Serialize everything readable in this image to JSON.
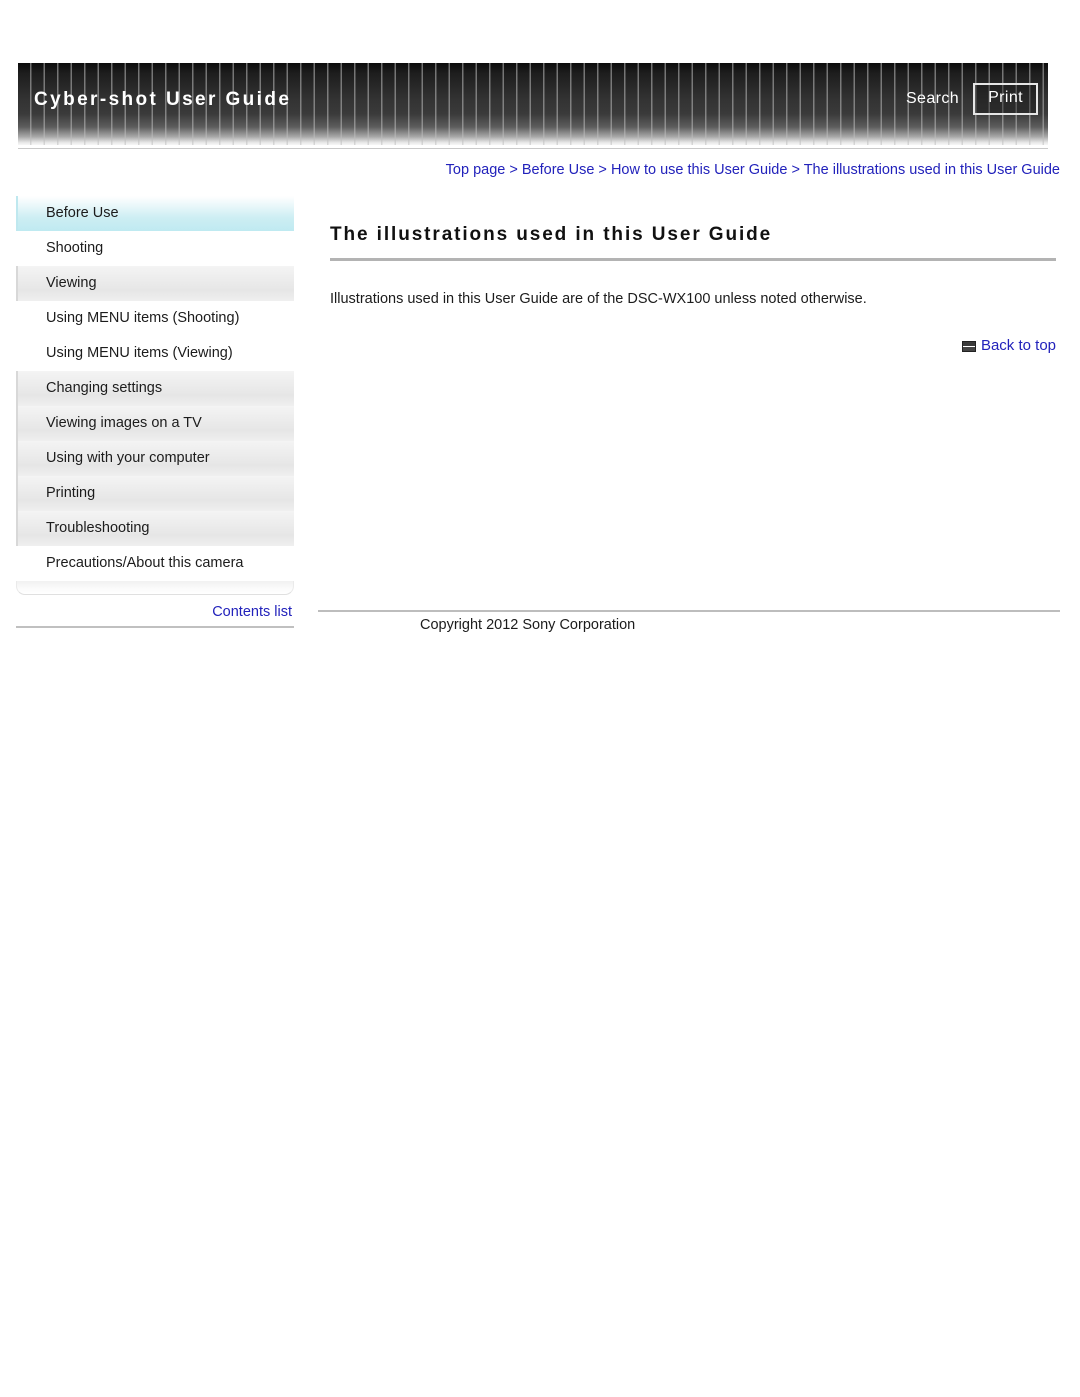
{
  "header": {
    "title": "Cyber-shot User Guide",
    "search_label": "Search",
    "print_label": "Print"
  },
  "breadcrumb": {
    "separator": " > ",
    "items": [
      "Top page",
      "Before Use",
      "How to use this User Guide",
      "The illustrations used in this User Guide"
    ]
  },
  "sidebar": {
    "items": [
      {
        "label": "Before Use",
        "state": "active"
      },
      {
        "label": "Shooting",
        "state": "plain"
      },
      {
        "label": "Viewing",
        "state": "shade"
      },
      {
        "label": "Using MENU items (Shooting)",
        "state": "plain"
      },
      {
        "label": "Using MENU items (Viewing)",
        "state": "plain"
      },
      {
        "label": "Changing settings",
        "state": "shade"
      },
      {
        "label": "Viewing images on a TV",
        "state": "shade"
      },
      {
        "label": "Using with your computer",
        "state": "shade"
      },
      {
        "label": "Printing",
        "state": "shade"
      },
      {
        "label": "Troubleshooting",
        "state": "shade"
      },
      {
        "label": "Precautions/About this camera",
        "state": "plain"
      }
    ],
    "contents_list_label": "Contents list"
  },
  "main": {
    "title": "The illustrations used in this User Guide",
    "paragraph": "Illustrations used in this User Guide are of the DSC-WX100 unless noted otherwise.",
    "back_to_top_label": "Back to top",
    "back_to_top_icon": "back-to-top-icon"
  },
  "footer": {
    "copyright": "Copyright 2012 Sony Corporation"
  },
  "colors": {
    "link": "#2222bb",
    "header_dark": "#1d1d1d",
    "active_nav": "#cdeef3",
    "rule": "#b3b3b3"
  }
}
